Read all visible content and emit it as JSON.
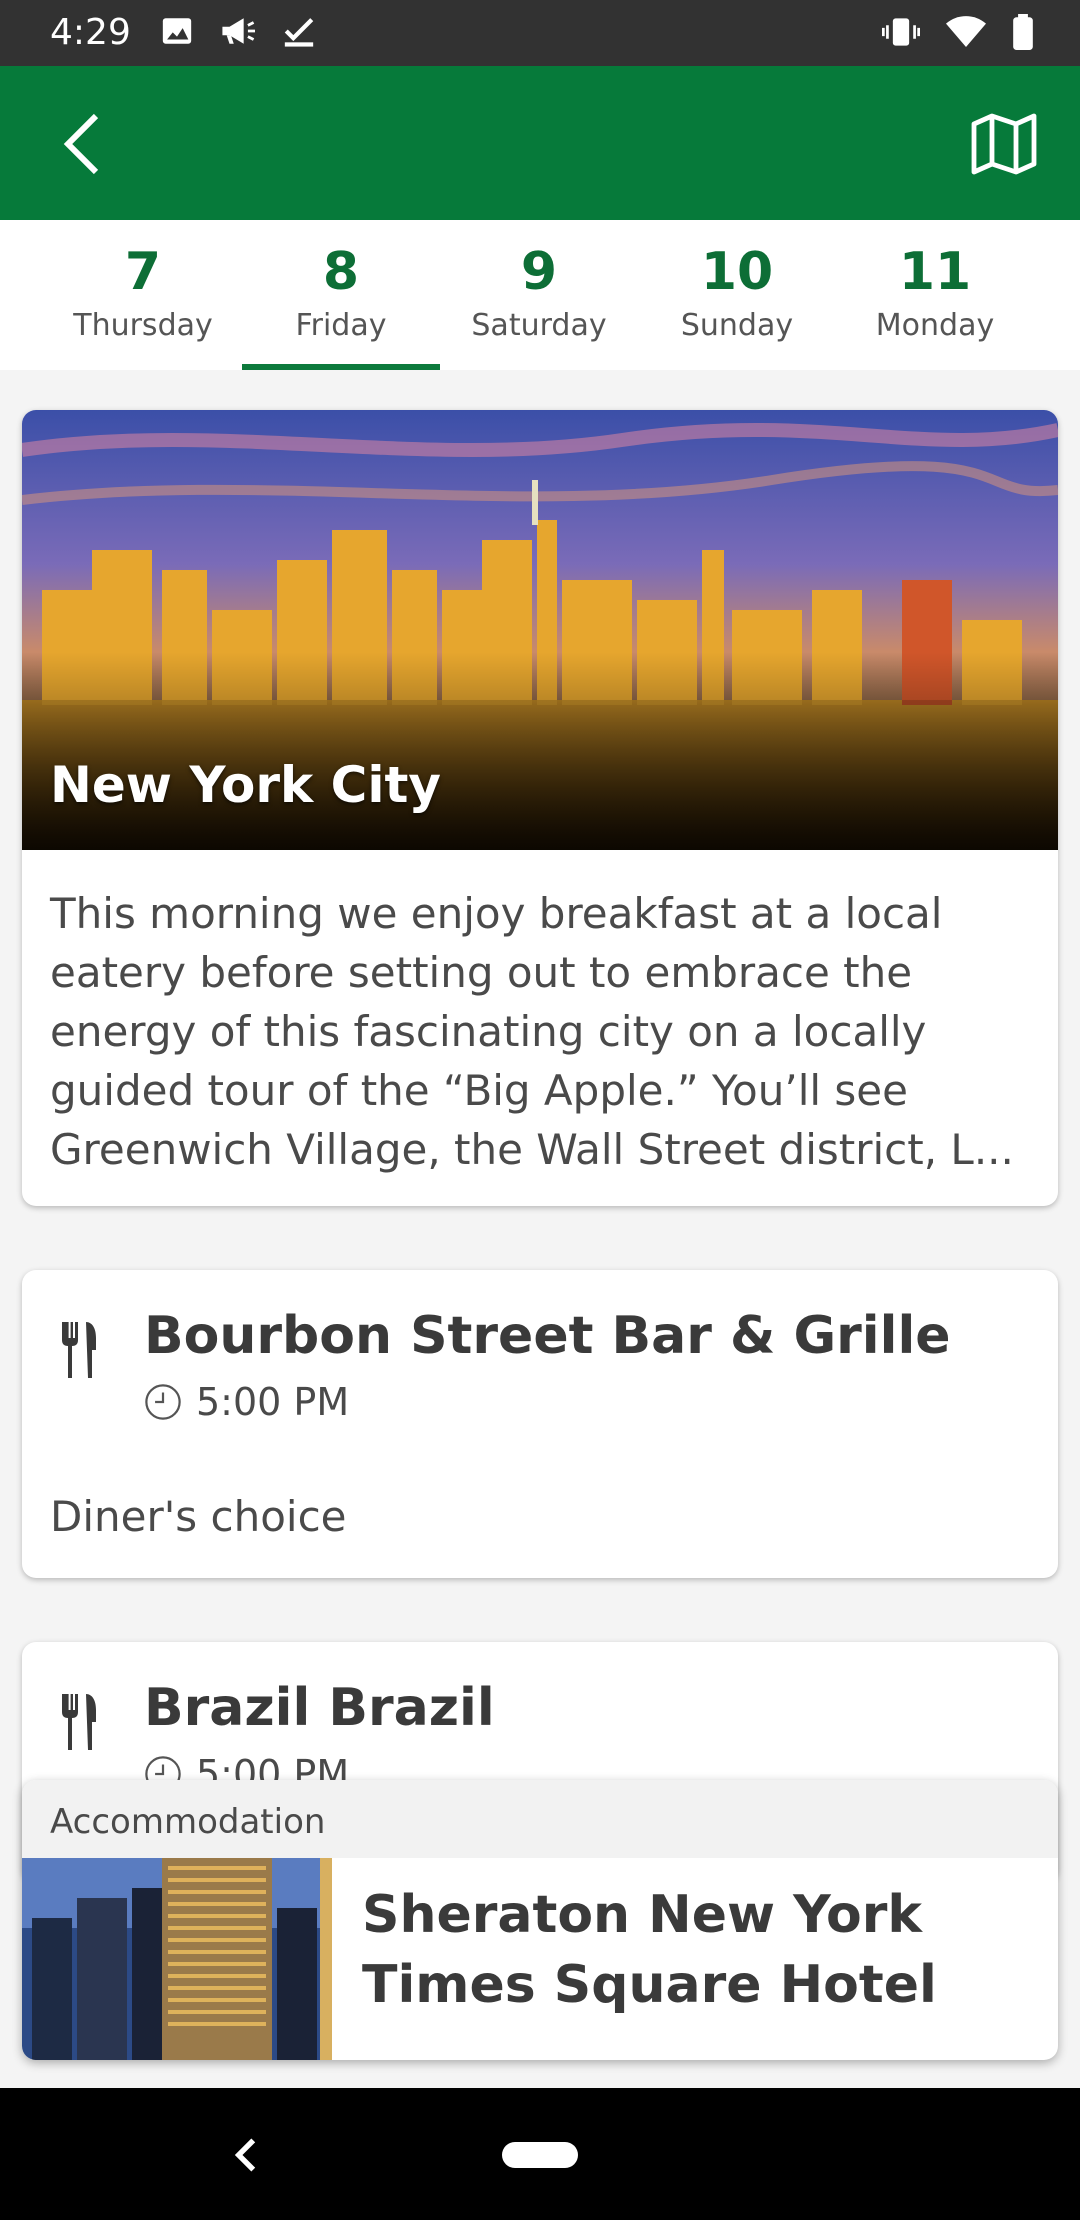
{
  "status_bar": {
    "time": "4:29",
    "left_icons": [
      "image-icon",
      "megaphone-icon",
      "checkbox-icon"
    ],
    "right_icons": [
      "vibrate-icon",
      "wifi-icon",
      "battery-icon"
    ]
  },
  "app_bar": {
    "back_icon": "back-arrow-icon",
    "map_icon": "map-icon",
    "color": "#067a3a"
  },
  "day_tabs": [
    {
      "num": "7",
      "label": "Thursday",
      "active": false
    },
    {
      "num": "8",
      "label": "Friday",
      "active": true
    },
    {
      "num": "9",
      "label": "Saturday",
      "active": false
    },
    {
      "num": "10",
      "label": "Sunday",
      "active": false
    },
    {
      "num": "11",
      "label": "Monday",
      "active": false
    }
  ],
  "destination": {
    "title": "New York City",
    "description": "This morning we enjoy breakfast at a local eatery before setting out to embrace the energy of this fascinating city on a locally guided tour of the “Big Apple.” You’ll see Greenwich Village, the Wall Street district, L..."
  },
  "meals": [
    {
      "name": "Bourbon Street Bar & Grille",
      "time": "5:00 PM",
      "note": "Diner's choice",
      "icon": "fork-knife-icon"
    },
    {
      "name": "Brazil Brazil",
      "time": "5:00 PM",
      "icon": "fork-knife-icon"
    }
  ],
  "accommodation": {
    "header": "Accommodation",
    "hotel_name": "Sheraton New York Times Square Hotel"
  },
  "nav_bar": {
    "back_icon": "nav-back-icon",
    "home_icon": "home-pill-icon"
  },
  "colors": {
    "accent": "#067a3a",
    "tab_number": "#0d6e36"
  }
}
